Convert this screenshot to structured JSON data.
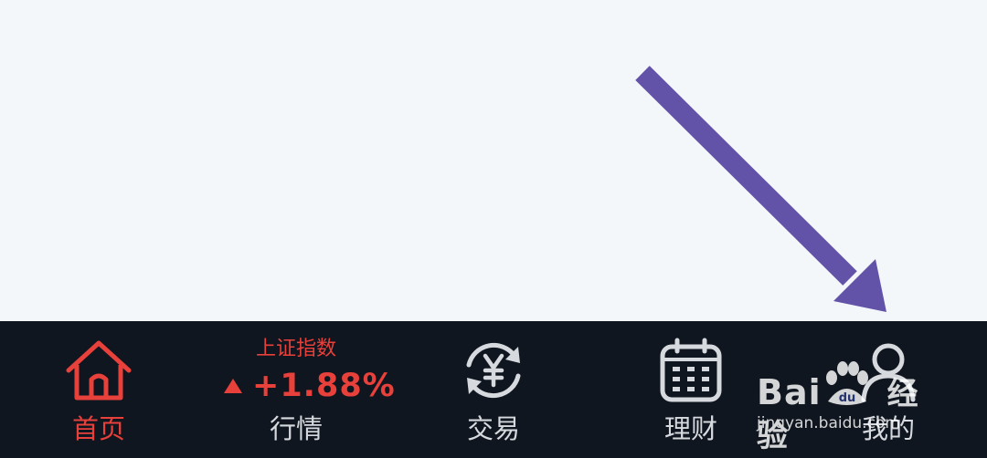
{
  "colors": {
    "background": "#f3f7fa",
    "tabbar": "#10161f",
    "active": "#e8403a",
    "inactive": "#d6d9de",
    "annotation_arrow": "#6353a8"
  },
  "tabbar": {
    "tabs": [
      {
        "id": "home",
        "label": "首页",
        "icon": "home-icon",
        "active": true
      },
      {
        "id": "market",
        "label": "行情",
        "icon": "index-ticker",
        "active": false
      },
      {
        "id": "trade",
        "label": "交易",
        "icon": "yuan-exchange-icon",
        "active": false
      },
      {
        "id": "finance",
        "label": "理财",
        "icon": "calendar-icon",
        "active": false
      },
      {
        "id": "mine",
        "label": "我的",
        "icon": "user-icon",
        "active": false
      }
    ],
    "index_ticker": {
      "name": "上证指数",
      "change": "+1.88%",
      "direction": "up"
    }
  },
  "watermark": {
    "brand_prefix": "Bai",
    "brand_suffix": "经验",
    "brand_paw_text": "du",
    "url": "jingyan.baidu.com"
  }
}
